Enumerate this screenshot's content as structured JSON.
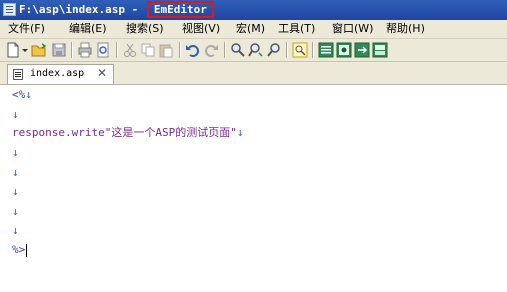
{
  "window": {
    "title_path": "F:\\asp\\index.asp - ",
    "app_name": "EmEditor"
  },
  "menu": [
    {
      "label": "文件(F)"
    },
    {
      "label": "编辑(E)"
    },
    {
      "label": "搜索(S)"
    },
    {
      "label": "视图(V)"
    },
    {
      "label": "宏(M)"
    },
    {
      "label": "工具(T)"
    },
    {
      "label": "窗口(W)"
    },
    {
      "label": "帮助(H)"
    }
  ],
  "toolbar": {
    "icons": [
      "new-file-icon",
      "dropdown-icon",
      "open-folder-icon",
      "save-icon",
      "print-icon",
      "print-preview-icon",
      "cut-icon",
      "copy-icon",
      "paste-icon",
      "undo-icon",
      "redo-icon",
      "find-icon",
      "find-next-icon",
      "find-previous-icon",
      "highlight-icon",
      "view-1-icon",
      "view-2-icon",
      "view-3-icon",
      "view-4-icon"
    ]
  },
  "tab": {
    "label": "index.asp",
    "close_glyph": "✕"
  },
  "editor": {
    "newline_mark": "↓",
    "lines": [
      {
        "text": "<%"
      },
      {
        "text": ""
      },
      {
        "text": "response.write\"这是一个ASP的测试页面\""
      },
      {
        "text": ""
      },
      {
        "text": ""
      },
      {
        "text": ""
      },
      {
        "text": ""
      },
      {
        "text": ""
      },
      {
        "text": "%>"
      }
    ]
  },
  "colors": {
    "title_bar": "#2f5fb8",
    "highlight_box": "#e01818",
    "code_text": "#7a2a8e",
    "newline_mark": "#3c63c8"
  }
}
